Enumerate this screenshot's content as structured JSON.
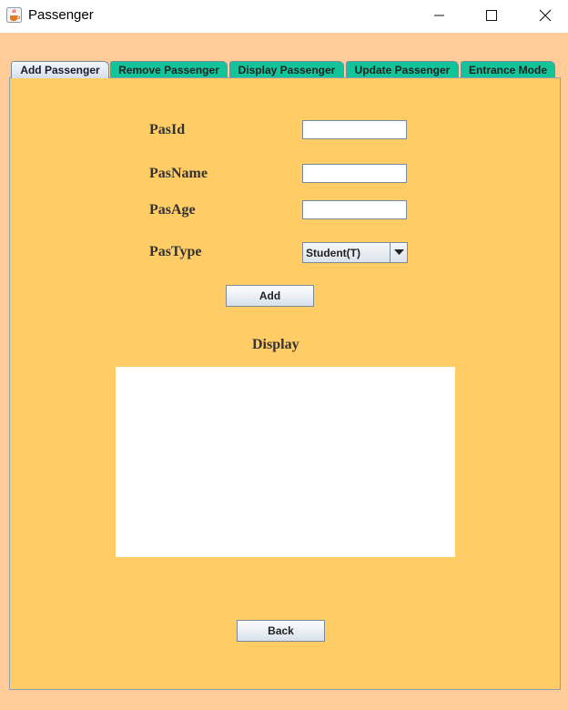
{
  "window": {
    "title": "Passenger",
    "icon": "java-coffee-icon"
  },
  "tabs": [
    {
      "label": "Add Passenger",
      "active": true
    },
    {
      "label": "Remove Passenger",
      "active": false
    },
    {
      "label": "Display Passenger",
      "active": false
    },
    {
      "label": "Update Passenger",
      "active": false
    },
    {
      "label": "Entrance Mode",
      "active": false
    }
  ],
  "form": {
    "pas_id_label": "PasId",
    "pas_id_value": "",
    "pas_name_label": "PasName",
    "pas_name_value": "",
    "pas_age_label": "PasAge",
    "pas_age_value": "",
    "pas_type_label": "PasType",
    "pas_type_selected": "Student(T)",
    "add_label": "Add",
    "display_label": "Display",
    "display_value": "",
    "back_label": "Back"
  },
  "colors": {
    "window_bg": "#FFCC99",
    "panel_bg": "#FFCC66",
    "inactive_tab": "#11C49A",
    "active_tab": "#DCE5EF"
  }
}
